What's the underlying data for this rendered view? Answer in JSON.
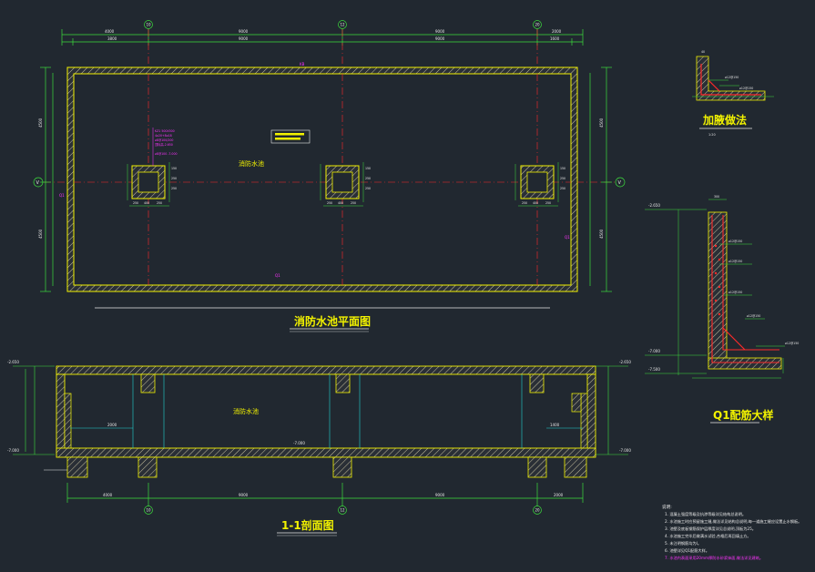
{
  "titles": {
    "plan": "消防水池平面图",
    "section": "1-1剖面图",
    "haunch": "加腋做法",
    "wall_detail": "Q1配筋大样"
  },
  "labels": {
    "pool_plan": "消防水池",
    "pool_section": "消防水池",
    "section_mark": "1"
  },
  "axis_labels": {
    "top": [
      "10",
      "12",
      "20"
    ],
    "bottom": [
      "10",
      "12",
      "20"
    ],
    "left": "V",
    "right": "V"
  },
  "elevations": {
    "sec_top_left": "-2.650",
    "sec_top_right": "-2.650",
    "sec_bottom_left": "-7.000",
    "sec_bottom_right": "-7.000",
    "sec_mid": "-7.000",
    "detail_top": "-2.650",
    "detail_bottom1": "-7.000",
    "detail_bottom2": "-7.500"
  },
  "notes": {
    "heading": "说明:",
    "lines": [
      "1. 混凝土强度等级及抗渗等级详见结构总说明。",
      "2. 水池施工时应预留施工缝,做法详见结构总说明,每一道施工缝应设置止水钢板。",
      "3. 池壁及底板钢筋保护层厚度详见总说明,顶板为25。",
      "4. 水池施工完毕后做满水试验,合格后再回填土方。",
      "5. 未注明钢筋均为Ⅰ。",
      "6. 池壁详见Q1配筋大样。"
    ],
    "highlight": "7. 水池内表面采用20mm厚防水砂浆抹面,做法详见建筑。"
  },
  "colors": {
    "background": "#212830",
    "wall": "#f2f200",
    "dimension": "#3ddc3d",
    "axis": "#ff2a2a",
    "annotation": "#ff33ff",
    "text": "#e8e8e8",
    "leader": "#22d3d3"
  }
}
